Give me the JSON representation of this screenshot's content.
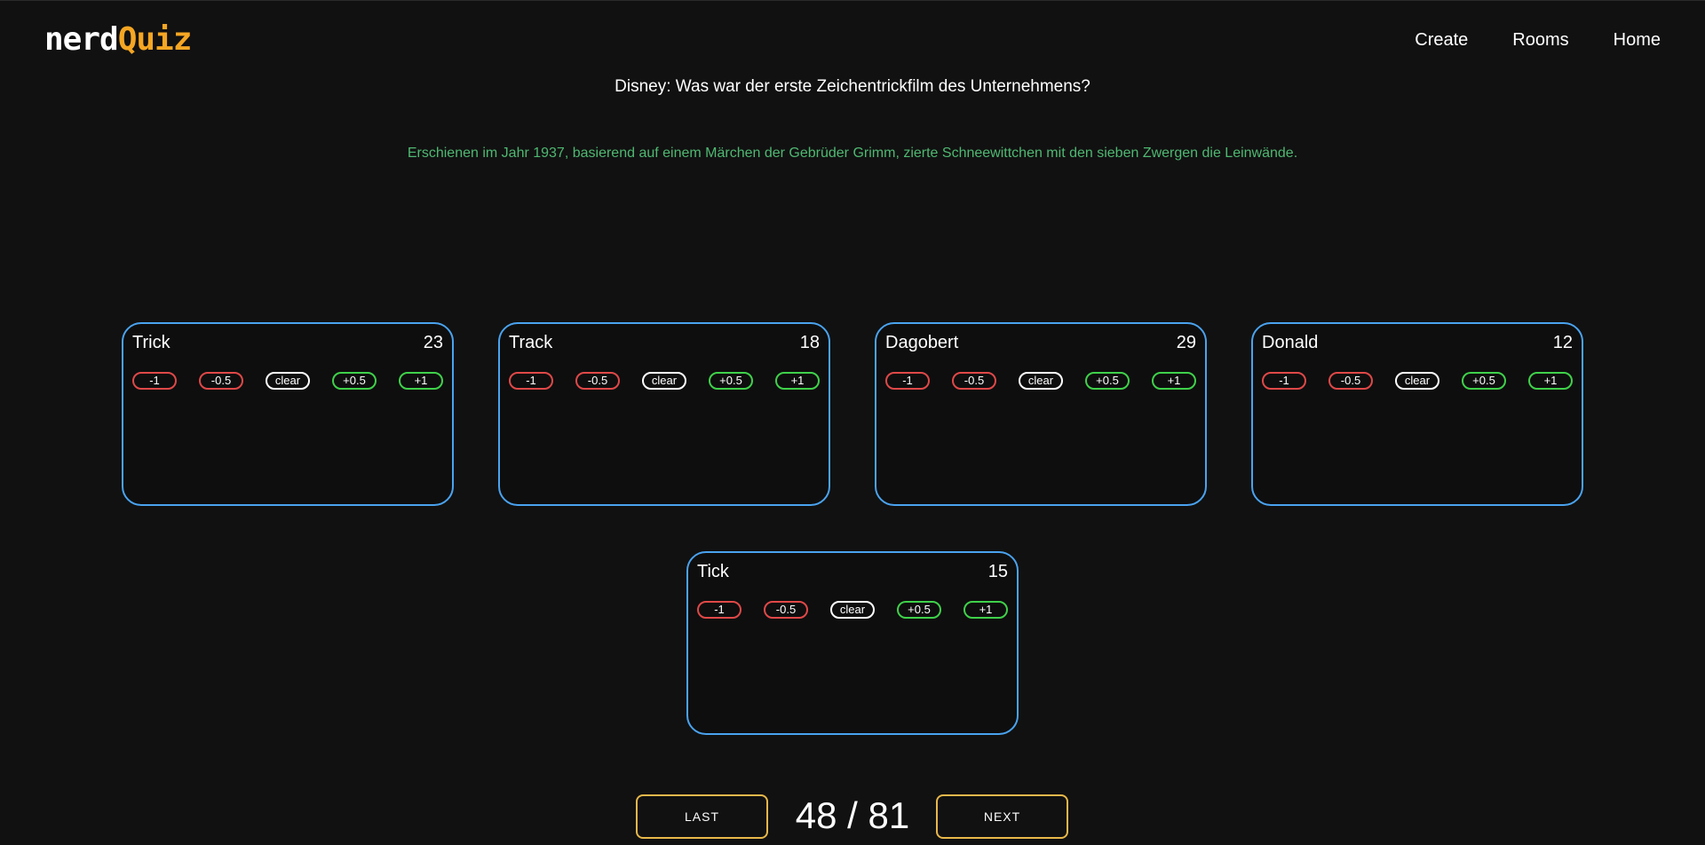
{
  "header": {
    "logo_part1": "nerd",
    "logo_part2": "Quiz",
    "nav": [
      "Create",
      "Rooms",
      "Home"
    ]
  },
  "question": {
    "text": "Disney: Was war der erste Zeichentrickfilm des Unternehmens?",
    "answer": "Erschienen im Jahr 1937, basierend auf einem Märchen der Gebrüder Grimm, zierte Schneewittchen mit den sieben Zwergen die Leinwände."
  },
  "score_buttons": [
    "-1",
    "-0.5",
    "clear",
    "+0.5",
    "+1"
  ],
  "players": [
    {
      "name": "Trick",
      "score": "23"
    },
    {
      "name": "Track",
      "score": "18"
    },
    {
      "name": "Dagobert",
      "score": "29"
    },
    {
      "name": "Donald",
      "score": "12"
    },
    {
      "name": "Tick",
      "score": "15"
    }
  ],
  "pager": {
    "prev_label": "LAST",
    "next_label": "NEXT",
    "counter": "48 / 81"
  },
  "colors": {
    "card_border": "#4aa3f0",
    "answer_text": "#4fb872",
    "negative": "#e04848",
    "positive": "#3fd14a",
    "pager_border": "#e8b84a",
    "logo_accent": "#f5a623"
  }
}
